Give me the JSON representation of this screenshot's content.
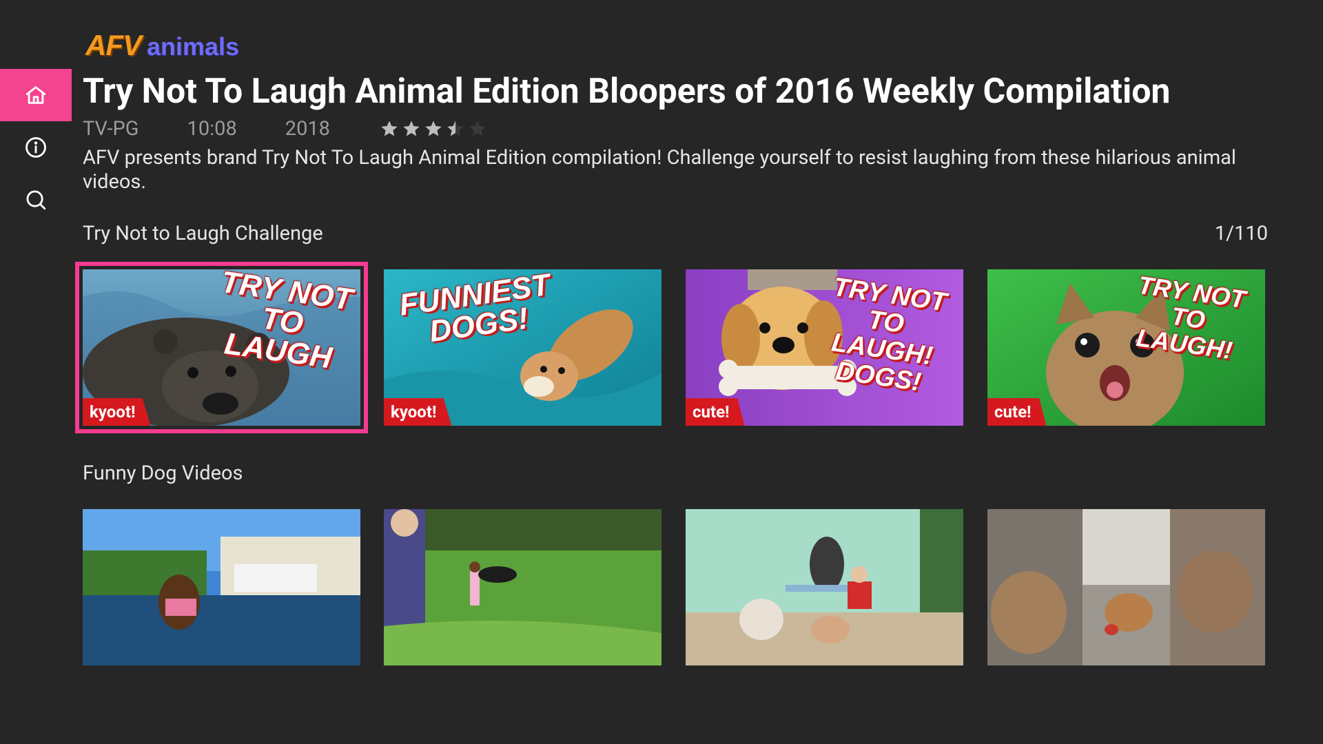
{
  "brand": {
    "logo_part1": "AFV",
    "logo_part2": "animals",
    "accent_color": "#f4448f"
  },
  "nav": {
    "items": [
      {
        "id": "home",
        "icon": "home-icon",
        "active": true
      },
      {
        "id": "info",
        "icon": "info-icon",
        "active": false
      },
      {
        "id": "search",
        "icon": "search-icon",
        "active": false
      }
    ]
  },
  "details": {
    "title": "Try Not To Laugh Animal Edition Bloopers of 2016 Weekly Compilation",
    "rating": "TV-PG",
    "duration": "10:08",
    "year": "2018",
    "stars": 3.5,
    "stars_max": 5,
    "description": "AFV presents brand Try Not To Laugh Animal Edition compilation! Challenge yourself to resist laughing from these hilarious animal videos."
  },
  "rows": [
    {
      "title": "Try Not to Laugh Challenge",
      "counter": "1/110",
      "cards": [
        {
          "headline": "TRY NOT TO LAUGH",
          "badge": "kyoot!",
          "focused": true
        },
        {
          "headline": "FUNNIEST DOGS!",
          "badge": "kyoot!"
        },
        {
          "headline": "TRY NOT TO LAUGH! DOGS!",
          "badge": "cute!"
        },
        {
          "headline": "TRY NOT TO LAUGH!",
          "badge": "cute!"
        }
      ]
    },
    {
      "title": "Funny Dog Videos",
      "cards": [
        {},
        {},
        {},
        {}
      ]
    }
  ]
}
